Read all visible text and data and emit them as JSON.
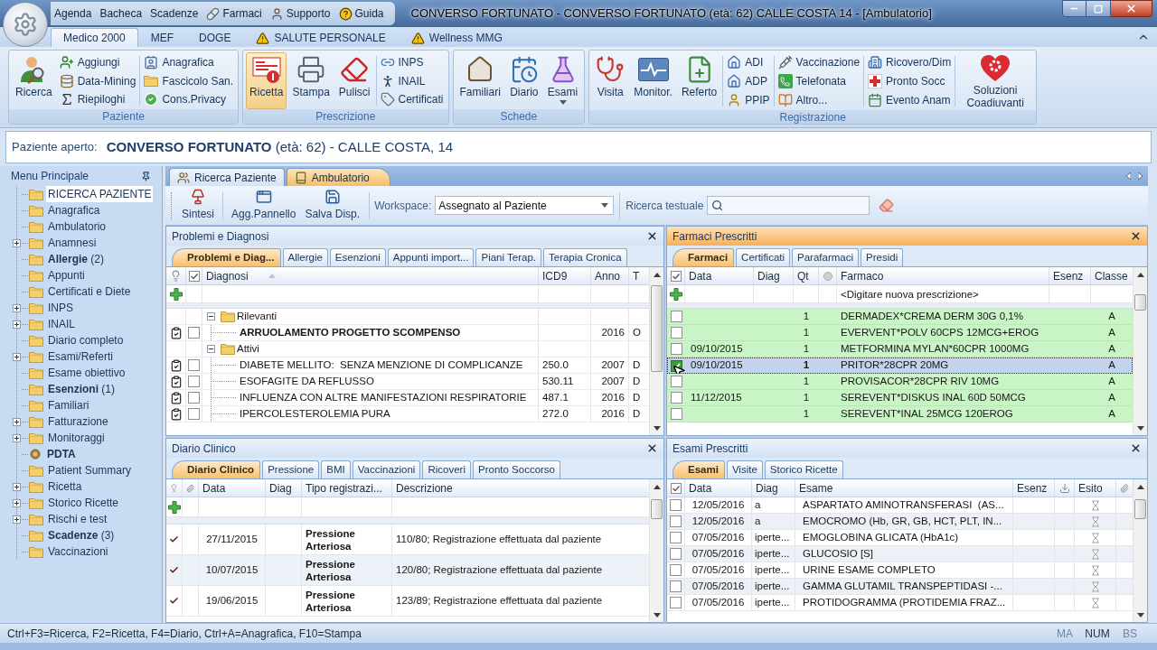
{
  "window": {
    "title": "CONVERSO FORTUNATO - CONVERSO FORTUNATO (età: 62) CALLE COSTA 14 - [Ambulatorio]"
  },
  "quick_access": [
    "Agenda",
    "Bacheca",
    "Scadenze",
    "Farmaci",
    "Supporto",
    "Guida"
  ],
  "ribbon": {
    "tabs": [
      {
        "label": "Medico 2000",
        "selected": true,
        "warning": false
      },
      {
        "label": "MEF",
        "selected": false,
        "warning": false
      },
      {
        "label": "DOGE",
        "selected": false,
        "warning": false
      },
      {
        "label": "SALUTE PERSONALE",
        "selected": false,
        "warning": true
      },
      {
        "label": "Wellness MMG",
        "selected": false,
        "warning": true
      }
    ],
    "groups": [
      {
        "label": "Paziente",
        "columns": [
          {
            "kind": "large",
            "label": "Ricerca",
            "highlighted": false,
            "dropdown": false
          },
          {
            "kind": "stack",
            "items": [
              "Aggiungi",
              "Data-Mining",
              "Riepiloghi"
            ]
          },
          {
            "kind": "stack",
            "items": [
              "Anagrafica",
              "Fascicolo San.",
              "Cons.Privacy"
            ]
          }
        ]
      },
      {
        "label": "Prescrizione",
        "columns": [
          {
            "kind": "large",
            "label": "Ricetta",
            "highlighted": true,
            "dropdown": false
          },
          {
            "kind": "large",
            "label": "Stampa",
            "highlighted": false,
            "dropdown": false
          },
          {
            "kind": "large",
            "label": "Pulisci",
            "highlighted": false,
            "dropdown": false
          },
          {
            "kind": "stack",
            "items": [
              "INPS",
              "INAIL",
              "Certificati"
            ]
          }
        ]
      },
      {
        "label": "Schede",
        "columns": [
          {
            "kind": "large",
            "label": "Familiari",
            "highlighted": false,
            "dropdown": false
          },
          {
            "kind": "large",
            "label": "Diario",
            "highlighted": false,
            "dropdown": false
          },
          {
            "kind": "large",
            "label": "Esami",
            "highlighted": false,
            "dropdown": true
          }
        ]
      },
      {
        "label": "Registrazione",
        "columns": [
          {
            "kind": "large",
            "label": "Visita",
            "highlighted": false,
            "dropdown": false
          },
          {
            "kind": "large",
            "label": "Monitor.",
            "highlighted": false,
            "dropdown": false
          },
          {
            "kind": "large",
            "label": "Referto",
            "highlighted": false,
            "dropdown": false
          },
          {
            "kind": "stack",
            "items": [
              "ADI",
              "ADP",
              "PPIP"
            ]
          },
          {
            "kind": "stack",
            "items": [
              "Vaccinazione",
              "Telefonata",
              "Altro..."
            ]
          },
          {
            "kind": "stack",
            "items": [
              "Ricovero/Dim",
              "Pronto Socc",
              "Evento Anam"
            ]
          },
          {
            "kind": "large",
            "label": "Soluzioni Coadiuvanti",
            "highlighted": false,
            "dropdown": false
          }
        ]
      }
    ]
  },
  "patient_bar": {
    "label": "Paziente aperto:",
    "value": "**CONVERSO FORTUNATO** (età: 62) - CALLE COSTA, 14"
  },
  "sidebar": {
    "title": "Menu Principale",
    "items": [
      {
        "label": "RICERCA PAZIENTE",
        "kind": "folder",
        "expandable": false,
        "selected": true
      },
      {
        "label": "Anagrafica",
        "kind": "folder",
        "expandable": false,
        "selected": false
      },
      {
        "label": "Ambulatorio",
        "kind": "folder",
        "expandable": false,
        "selected": false
      },
      {
        "label": "Anamnesi",
        "kind": "folder",
        "expandable": true,
        "selected": false
      },
      {
        "label": "**Allergie** (2)",
        "kind": "folder",
        "expandable": false,
        "selected": false
      },
      {
        "label": "Appunti",
        "kind": "folder",
        "expandable": false,
        "selected": false
      },
      {
        "label": "Certificati e Diete",
        "kind": "folder",
        "expandable": false,
        "selected": false
      },
      {
        "label": "INPS",
        "kind": "folder",
        "expandable": true,
        "selected": false
      },
      {
        "label": "INAIL",
        "kind": "folder",
        "expandable": true,
        "selected": false
      },
      {
        "label": "Diario completo",
        "kind": "folder",
        "expandable": false,
        "selected": false
      },
      {
        "label": "Esami/Referti",
        "kind": "folder",
        "expandable": true,
        "selected": false
      },
      {
        "label": "Esame obiettivo",
        "kind": "folder",
        "expandable": false,
        "selected": false
      },
      {
        "label": "**Esenzioni** (1)",
        "kind": "folder",
        "expandable": false,
        "selected": false
      },
      {
        "label": "Familiari",
        "kind": "folder",
        "expandable": false,
        "selected": false
      },
      {
        "label": "Fatturazione",
        "kind": "folder",
        "expandable": true,
        "selected": false
      },
      {
        "label": "Monitoraggi",
        "kind": "folder",
        "expandable": true,
        "selected": false
      },
      {
        "label": "PDTA",
        "kind": "pdta",
        "expandable": false,
        "selected": false
      },
      {
        "label": "Patient Summary",
        "kind": "folder",
        "expandable": false,
        "selected": false
      },
      {
        "label": "Ricetta",
        "kind": "folder",
        "expandable": true,
        "selected": false
      },
      {
        "label": "Storico Ricette",
        "kind": "folder",
        "expandable": true,
        "selected": false
      },
      {
        "label": "Rischi e test",
        "kind": "folder",
        "expandable": true,
        "selected": false
      },
      {
        "label": "**Scadenze** (3)",
        "kind": "folder",
        "expandable": false,
        "selected": false
      },
      {
        "label": "Vaccinazioni",
        "kind": "folder",
        "expandable": false,
        "selected": false
      }
    ]
  },
  "documents": {
    "tabs": [
      {
        "label": "Ricerca Paziente",
        "selected": false
      },
      {
        "label": "Ambulatorio",
        "selected": true
      }
    ]
  },
  "toolbar": {
    "buttons": [
      "Sintesi",
      "Agg.Pannello",
      "Salva Disp."
    ],
    "workspace_label": "Workspace:",
    "workspace_value": "Assegnato al Paziente",
    "search_label": "Ricerca testuale"
  },
  "problems": {
    "title": "Problemi e Diagnosi",
    "active": false,
    "tabs": [
      {
        "label": "Problemi e Diag...",
        "selected": true
      },
      {
        "label": "Allergie",
        "selected": false
      },
      {
        "label": "Esenzioni",
        "selected": false
      },
      {
        "label": "Appunti import...",
        "selected": false
      },
      {
        "label": "Piani Terap.",
        "selected": false
      },
      {
        "label": "Terapia Cronica",
        "selected": false
      }
    ],
    "columns": [
      "Diagnosi",
      "ICD9",
      "Anno",
      "T"
    ],
    "groups": [
      {
        "label": "Rilevanti",
        "expanded": true,
        "children": [
          {
            "diagnosis": "ARRUOLAMENTO PROGETTO SCOMPENSO",
            "year": "2016",
            "type": "O",
            "bold": true,
            "marked": true,
            "checked": false
          }
        ]
      },
      {
        "label": "Attivi",
        "expanded": true,
        "children": [
          {
            "diagnosis": "DIABETE MELLITO:  SENZA MENZIONE DI COMPLICANZE",
            "icd9": "250.0",
            "year": "2007",
            "type": "D",
            "bold": false,
            "marked": true,
            "checked": false
          },
          {
            "diagnosis": "ESOFAGITE DA REFLUSSO",
            "icd9": "530.11",
            "year": "2007",
            "type": "D",
            "bold": false,
            "marked": true,
            "checked": false
          },
          {
            "diagnosis": "INFLUENZA CON ALTRE MANIFESTAZIONI RESPIRATORIE",
            "icd9": "487.1",
            "year": "2016",
            "type": "D",
            "bold": false,
            "marked": true,
            "checked": false
          },
          {
            "diagnosis": "IPERCOLESTEROLEMIA PURA",
            "icd9": "272.0",
            "year": "2016",
            "type": "D",
            "bold": false,
            "marked": true,
            "checked": false
          }
        ]
      }
    ]
  },
  "drugs": {
    "title": "Farmaci Prescritti",
    "active": true,
    "tabs": [
      {
        "label": "Farmaci",
        "selected": true
      },
      {
        "label": "Certificati",
        "selected": false
      },
      {
        "label": "Parafarmaci",
        "selected": false
      },
      {
        "label": "Presidi",
        "selected": false
      }
    ],
    "columns": [
      "Data",
      "Diag",
      "Qt",
      "Farmaco",
      "Esenz",
      "Classe"
    ],
    "new_row": {
      "placeholder": "<Digitare nuova prescrizione>"
    },
    "rows": [
      {
        "qty": "1",
        "drug": "DERMADEX*CREMA DERM 30G 0,1%",
        "class": "A",
        "checked": false,
        "selected": false
      },
      {
        "qty": "1",
        "drug": "EVERVENT*POLV 60CPS 12MCG+EROG",
        "class": "A",
        "checked": false,
        "selected": false
      },
      {
        "date": "09/10/2015",
        "qty": "1",
        "drug": "METFORMINA MYLAN*60CPR 1000MG",
        "class": "A",
        "checked": false,
        "selected": false
      },
      {
        "date": "09/10/2015",
        "qty": "1",
        "drug": "PRITOR*28CPR 20MG",
        "class": "A",
        "checked": true,
        "selected": true
      },
      {
        "qty": "1",
        "drug": "PROVISACOR*28CPR RIV 10MG",
        "class": "A",
        "checked": false,
        "selected": false
      },
      {
        "date": "11/12/2015",
        "qty": "1",
        "drug": "SEREVENT*DISKUS INAL 60D 50MCG",
        "class": "A",
        "checked": false,
        "selected": false
      },
      {
        "qty": "1",
        "drug": "SEREVENT*INAL 25MCG 120EROG",
        "class": "A",
        "checked": false,
        "selected": false
      }
    ]
  },
  "diary": {
    "title": "Diario Clinico",
    "active": false,
    "tabs": [
      {
        "label": "Diario Clinico",
        "selected": true
      },
      {
        "label": "Pressione",
        "selected": false
      },
      {
        "label": "BMI",
        "selected": false
      },
      {
        "label": "Vaccinazioni",
        "selected": false
      },
      {
        "label": "Ricoveri",
        "selected": false
      },
      {
        "label": "Pronto Soccorso",
        "selected": false
      }
    ],
    "columns": [
      "Data",
      "Diag",
      "Tipo registrazi...",
      "Descrizione"
    ],
    "rows": [
      {
        "marked": true,
        "date": "27/11/2015",
        "type": "Pressione Arteriosa",
        "description": "110/80; Registrazione effettuata dal paziente"
      },
      {
        "marked": true,
        "date": "10/07/2015",
        "type": "Pressione Arteriosa",
        "description": "120/80; Registrazione effettuata dal paziente"
      },
      {
        "marked": true,
        "date": "19/06/2015",
        "type": "Pressione Arteriosa",
        "description": "123/89; Registrazione effettuata dal paziente"
      }
    ]
  },
  "exams": {
    "title": "Esami Prescritti",
    "active": false,
    "tabs": [
      {
        "label": "Esami",
        "selected": true
      },
      {
        "label": "Visite",
        "selected": false
      },
      {
        "label": "Storico Ricette",
        "selected": false
      }
    ],
    "columns": [
      "Data",
      "Diag",
      "Esame",
      "Esenz",
      "Esito"
    ],
    "rows": [
      {
        "checked": false,
        "date": "12/05/2016",
        "diag": "a",
        "exam": "ASPARTATO AMINOTRANSFERASI  (AS..."
      },
      {
        "checked": false,
        "date": "12/05/2016",
        "diag": "a",
        "exam": "EMOCROMO (Hb, GR, GB, HCT, PLT, IN..."
      },
      {
        "checked": false,
        "date": "07/05/2016",
        "diag": "iperte...",
        "exam": "EMOGLOBINA GLICATA (HbA1c)"
      },
      {
        "checked": false,
        "date": "07/05/2016",
        "diag": "iperte...",
        "exam": "GLUCOSIO [S]"
      },
      {
        "checked": false,
        "date": "07/05/2016",
        "diag": "iperte...",
        "exam": "URINE ESAME COMPLETO"
      },
      {
        "checked": false,
        "date": "07/05/2016",
        "diag": "iperte...",
        "exam": "GAMMA GLUTAMIL TRANSPEPTIDASI -..."
      },
      {
        "checked": false,
        "date": "07/05/2016",
        "diag": "iperte...",
        "exam": "PROTIDOGRAMMA (PROTIDEMIA FRAZ..."
      }
    ]
  },
  "status_bar": {
    "text": "Ctrl+F3=Ricerca, F2=Ricetta, F4=Diario, Ctrl+A=Anagrafica, F10=Stampa",
    "indicators": [
      {
        "label": "MA",
        "on": false
      },
      {
        "label": "NUM",
        "on": true
      },
      {
        "label": "BS",
        "on": false
      }
    ]
  }
}
